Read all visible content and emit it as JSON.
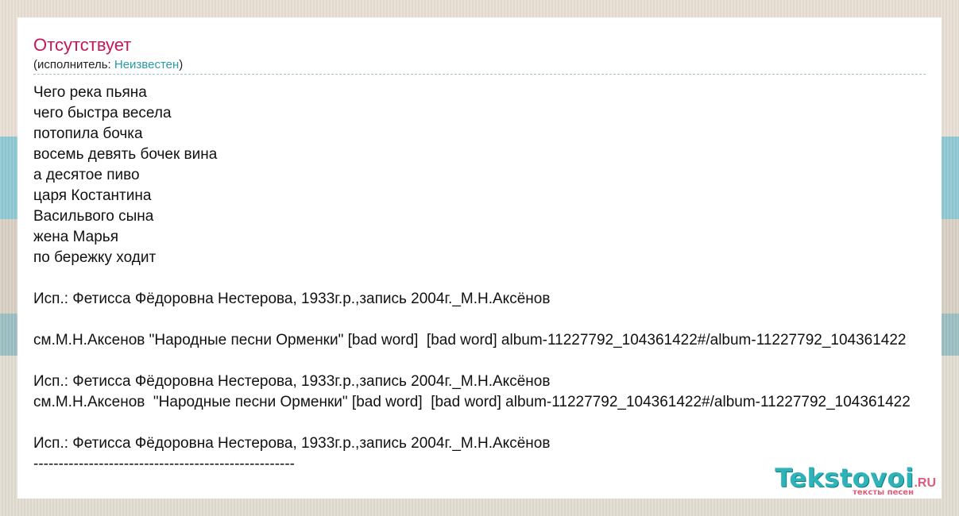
{
  "song": {
    "title": "Отсутствует",
    "artist_prefix": "(исполнитель: ",
    "artist": "Неизвестен",
    "artist_suffix": ")"
  },
  "lyrics": [
    "Чего река пьяна",
    "чего быстра весела",
    "потопила бочка",
    "восемь девять бочек вина",
    "а десятое пиво",
    "царя Костантина",
    "Васильвого сына",
    "жена Марья",
    "по бережку ходит",
    "",
    "Исп.: Фетисса Фёдоровна Нестерова, 1933г.р.,запись 2004г._М.Н.Аксёнов",
    "",
    "см.М.Н.Аксенов \"Народные песни Орменки\" [bad word]  [bad word] album-11227792_104361422#/album-11227792_104361422",
    "",
    "Исп.: Фетисса Фёдоровна Нестерова, 1933г.р.,запись 2004г._М.Н.Аксёнов",
    "см.М.Н.Аксенов  \"Народные песни Орменки\" [bad word]  [bad word] album-11227792_104361422#/album-11227792_104361422",
    "",
    "Исп.: Фетисса Фёдоровна Нестерова, 1933г.р.,запись 2004г._М.Н.Аксёнов",
    "----------------------------------------------------"
  ],
  "logo": {
    "brand": "Tekstovoi",
    "tld": ".RU",
    "tagline": "тексты песен"
  }
}
